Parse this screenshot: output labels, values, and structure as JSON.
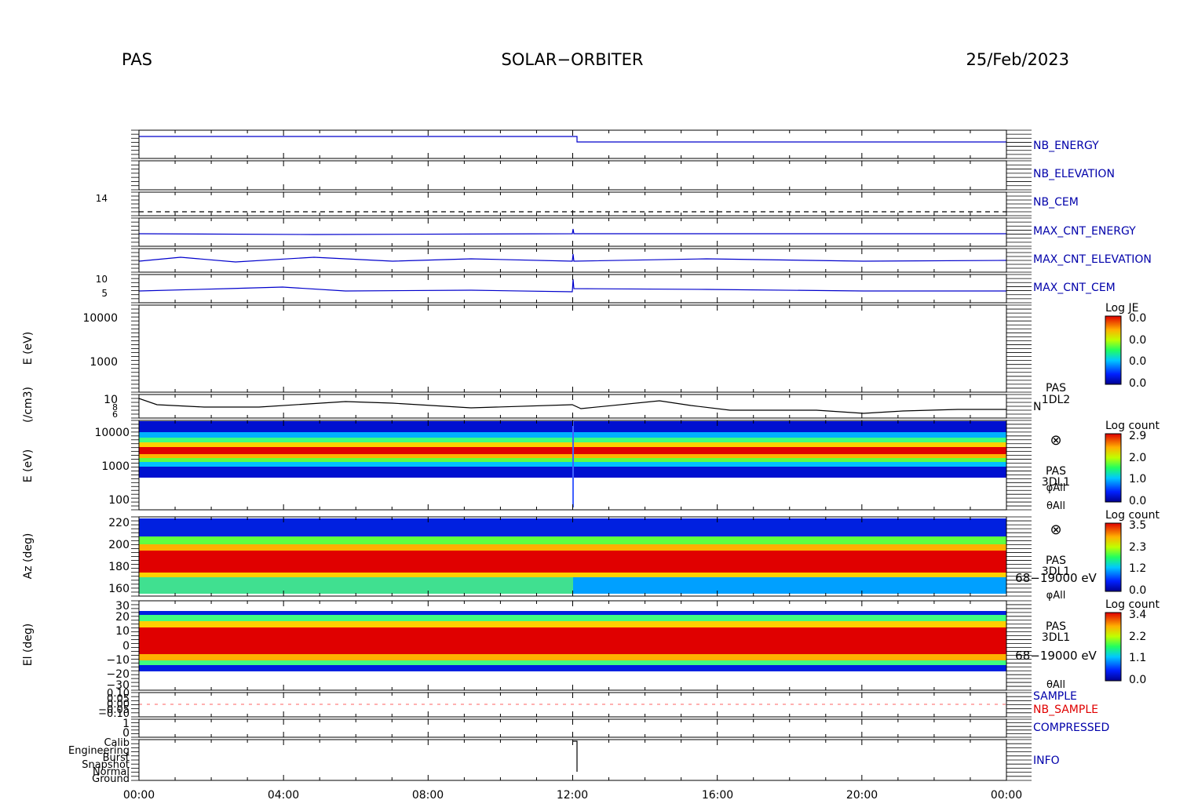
{
  "header": {
    "instrument": "PAS",
    "mission": "SOLAR−ORBITER",
    "date": "25/Feb/2023"
  },
  "time_axis": {
    "ticks": [
      "00:00",
      "04:00",
      "08:00",
      "12:00",
      "16:00",
      "20:00",
      "00:00"
    ],
    "range_hours": [
      0,
      24
    ]
  },
  "colors": {
    "blue_line": "#0000cc",
    "red_line": "#e00000",
    "black_line": "#000000",
    "frame": "#000000"
  },
  "chart_data": [
    {
      "id": "nb_energy",
      "type": "line",
      "label": "NB_ENERGY",
      "label_color": "#0000aa",
      "series": [
        {
          "x": [
            0,
            12,
            12.1,
            24
          ],
          "y": [
            96,
            96,
            80,
            80
          ]
        }
      ]
    },
    {
      "id": "nb_elevation",
      "type": "line",
      "label": "NB_ELEVATION",
      "label_color": "#0000aa"
    },
    {
      "id": "nb_cem",
      "type": "line",
      "label": "NB_CEM",
      "label_color": "#0000aa",
      "ytick_labels": [
        "14"
      ]
    },
    {
      "id": "max_cnt_energy",
      "type": "line",
      "label": "MAX_CNT_ENERGY",
      "label_color": "#0000aa"
    },
    {
      "id": "max_cnt_elevation",
      "type": "line",
      "label": "MAX_CNT_ELEVATION",
      "label_color": "#0000aa"
    },
    {
      "id": "max_cnt_cem",
      "type": "line",
      "label": "MAX_CNT_CEM",
      "label_color": "#0000aa",
      "ytick_labels": [
        "10",
        "5"
      ]
    },
    {
      "id": "je_spectrogram",
      "type": "heatmap",
      "ylabel": "E (eV)",
      "ytick_labels": [
        "10000",
        "1000"
      ],
      "colorbar": {
        "title": "Log JE",
        "ticks": [
          "0.0",
          "0.0",
          "0.0",
          "0.0"
        ]
      }
    },
    {
      "id": "density",
      "type": "line",
      "ylabel": "(/cm3)",
      "ytick_labels": [
        "10",
        "8",
        "6"
      ],
      "label": "N",
      "side_text": [
        "PAS",
        "1DL2"
      ]
    },
    {
      "id": "energy_spectrogram",
      "type": "heatmap",
      "ylabel": "E (eV)",
      "ytick_labels": [
        "10000",
        "1000",
        "100"
      ],
      "colorbar": {
        "title": "Log count",
        "ticks": [
          "2.9",
          "2.0",
          "1.0",
          "0.0"
        ]
      },
      "side_text": [
        "⊗",
        "PAS",
        "3DL1",
        "φAll",
        "θAll"
      ]
    },
    {
      "id": "azimuth_spectrogram",
      "type": "heatmap",
      "ylabel": "Az (deg)",
      "ytick_labels": [
        "220",
        "200",
        "180",
        "160"
      ],
      "colorbar": {
        "title": "Log count",
        "ticks": [
          "3.5",
          "2.3",
          "1.2",
          "0.0"
        ]
      },
      "side_text": [
        "⊗",
        "PAS",
        "3DL1",
        "68−19000 eV",
        "φAll"
      ]
    },
    {
      "id": "elevation_spectrogram",
      "type": "heatmap",
      "ylabel": "El (deg)",
      "ytick_labels": [
        "30",
        "20",
        "10",
        "0",
        "−10",
        "−20",
        "−30"
      ],
      "colorbar": {
        "title": "Log count",
        "ticks": [
          "3.4",
          "2.2",
          "1.1",
          "0.0"
        ]
      },
      "side_text": [
        "PAS",
        "3DL1",
        "68−19000 eV",
        "θAll"
      ]
    },
    {
      "id": "sample",
      "type": "line",
      "labels": [
        {
          "text": "SAMPLE",
          "color": "#0000aa"
        },
        {
          "text": "NB_SAMPLE",
          "color": "#e00000"
        }
      ],
      "ytick_labels": [
        "0.10",
        "0.05",
        "0.00",
        "−0.05",
        "−0.10"
      ]
    },
    {
      "id": "compressed",
      "type": "line",
      "label": "COMPRESSED",
      "label_color": "#0000aa",
      "ytick_labels": [
        "1",
        "0"
      ]
    },
    {
      "id": "info",
      "type": "line",
      "label": "INFO",
      "label_color": "#0000aa",
      "ytick_labels": [
        "Calib",
        "Engineering",
        "Burst",
        "Snapshot",
        "Normal",
        "Ground"
      ]
    }
  ]
}
